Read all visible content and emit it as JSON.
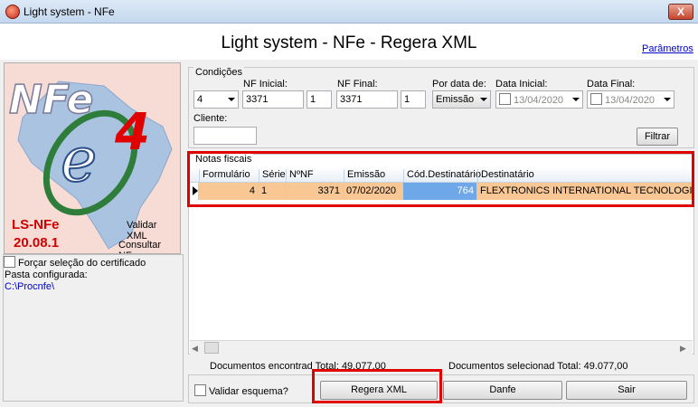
{
  "window": {
    "title": "Light system - NFe",
    "close_glyph": "X"
  },
  "header": {
    "title": "Light system - NFe - Regera XML",
    "params_link": "Parâmetros"
  },
  "logo": {
    "brand": "NFe",
    "version_digit": "4",
    "product": "LS-NFe",
    "version": "20.08.1",
    "link_validar": "Validar XML",
    "link_consultar": "Consultar NFe"
  },
  "left": {
    "force_cert_label": "Forçar seleção do certificado",
    "pasta_label": "Pasta configurada:",
    "pasta_value": "C:\\Procnfe\\"
  },
  "conditions": {
    "group_label": "Condições",
    "serie_value": "4",
    "nf_inicial_label": "NF Inicial:",
    "nf_inicial_value": "3371",
    "nf_inicial_serie": "1",
    "nf_final_label": "NF Final:",
    "nf_final_value": "3371",
    "nf_final_serie": "1",
    "por_data_label": "Por data de:",
    "por_data_value": "Emissão",
    "data_inicial_label": "Data Inicial:",
    "data_inicial_value": "13/04/2020",
    "data_final_label": "Data Final:",
    "data_final_value": "13/04/2020",
    "cliente_label": "Cliente:",
    "cliente_value": "",
    "filtrar_label": "Filtrar"
  },
  "notas": {
    "group_label": "Notas fiscais",
    "columns": [
      "Formulário",
      "Série",
      "NºNF",
      "Emissão",
      "Cód.Destinatário",
      "Destinatário"
    ],
    "rows": [
      {
        "formulario": "4",
        "serie": "1",
        "nf": "3371",
        "emissao": "07/02/2020",
        "cod_dest": "764",
        "destinatario": "FLEXTRONICS INTERNATIONAL TECNOLOGIA"
      }
    ]
  },
  "status": {
    "left_text": "Documentos encontrad Total: 49.077,00",
    "right_text": "Documentos selecionad Total: 49.077,00"
  },
  "footer": {
    "validar_label": "Validar esquema?",
    "regera_label": "Regera XML",
    "danfe_label": "Danfe",
    "sair_label": "Sair"
  },
  "colors": {
    "highlight_red": "#e00000",
    "row_bg": "#f9c794",
    "selected_cell": "#6ea8e8",
    "link": "#0000cc"
  }
}
